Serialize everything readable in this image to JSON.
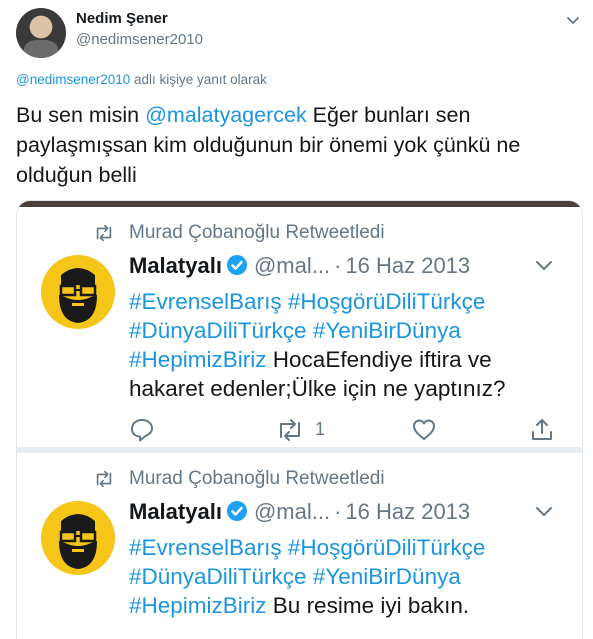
{
  "tweet": {
    "author_name": "Nedim Şener",
    "author_handle": "@nedimsener2010",
    "reply_mention": "@nedimsener2010",
    "reply_suffix": " adlı kişiye yanıt olarak",
    "text_before": "Bu sen misin ",
    "text_mention": "@malatyagercek",
    "text_after": " Eğer bunları sen paylaşmışsan kim olduğunun bir önemi yok çünkü ne olduğun belli"
  },
  "embedded": [
    {
      "retweeted_by": "Murad Çobanoğlu Retweetledi",
      "name": "Malatyalı",
      "handle": "@mal...",
      "dot": "·",
      "date": "16 Haz 2013",
      "tags": [
        "#EvrenselBarış",
        "#HoşgörüDiliTürkçe",
        "#DünyaDiliTürkçe",
        "#YeniBirDünya",
        "#HepimizBiriz"
      ],
      "text": "HocaEfendiye iftira ve hakaret edenler;Ülke için ne yaptınız?",
      "retweet_count": "1"
    },
    {
      "retweeted_by": "Murad Çobanoğlu Retweetledi",
      "name": "Malatyalı",
      "handle": "@mal...",
      "dot": "·",
      "date": "16 Haz 2013",
      "tags": [
        "#EvrenselBarış",
        "#HoşgörüDiliTürkçe",
        "#DünyaDiliTürkçe",
        "#YeniBirDünya",
        "#HepimizBiriz"
      ],
      "text": "Bu resime iyi bakın."
    }
  ],
  "colors": {
    "link": "#1b95e0",
    "secondary_text": "#657786",
    "primary_text": "#14171a",
    "avatar_yellow": "#f5c518",
    "verified_blue": "#1da1f2"
  },
  "icons": {
    "retweeted": "retweet-icon",
    "verified": "verified-badge-icon",
    "caret": "chevron-down-icon",
    "reply": "reply-icon",
    "retweet": "retweet-icon",
    "like": "heart-icon",
    "share": "share-icon"
  }
}
